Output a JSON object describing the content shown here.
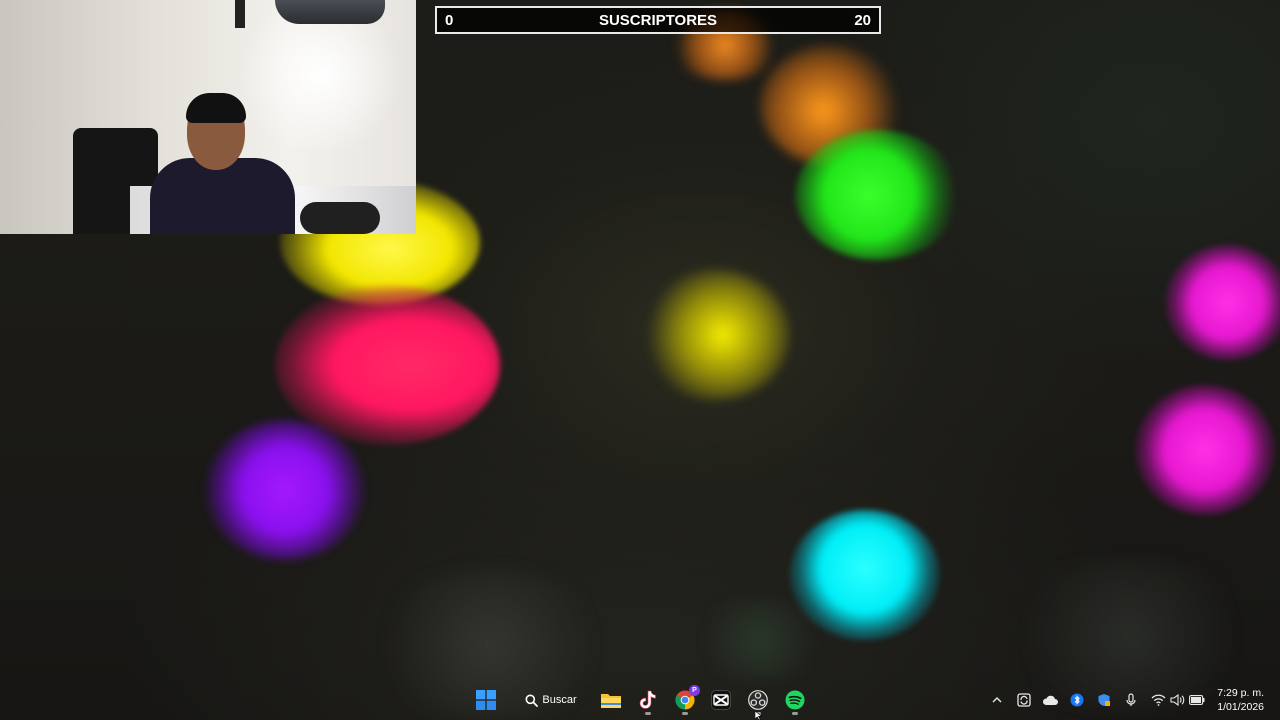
{
  "scoreboard": {
    "left_value": "0",
    "title": "SUSCRIPTORES",
    "right_value": "20"
  },
  "taskbar": {
    "search_label": "Buscar",
    "apps": [
      "start-icon",
      "search-icon",
      "file-explorer-icon",
      "tiktok-icon",
      "chrome-icon",
      "capcut-icon",
      "obs-icon",
      "spotify-icon"
    ],
    "chrome_profile_badge": "P",
    "clock_time": "7:29 p. m.",
    "clock_date": "1/01/2026"
  },
  "colors": {
    "accent_green": "#2bff2b",
    "accent_yellow": "#f5f000",
    "accent_magenta": "#ff22dd",
    "accent_cyan": "#00f5ff",
    "accent_red": "#ff1760",
    "accent_purple": "#9a10ff",
    "accent_orange": "#ff8a1a"
  }
}
